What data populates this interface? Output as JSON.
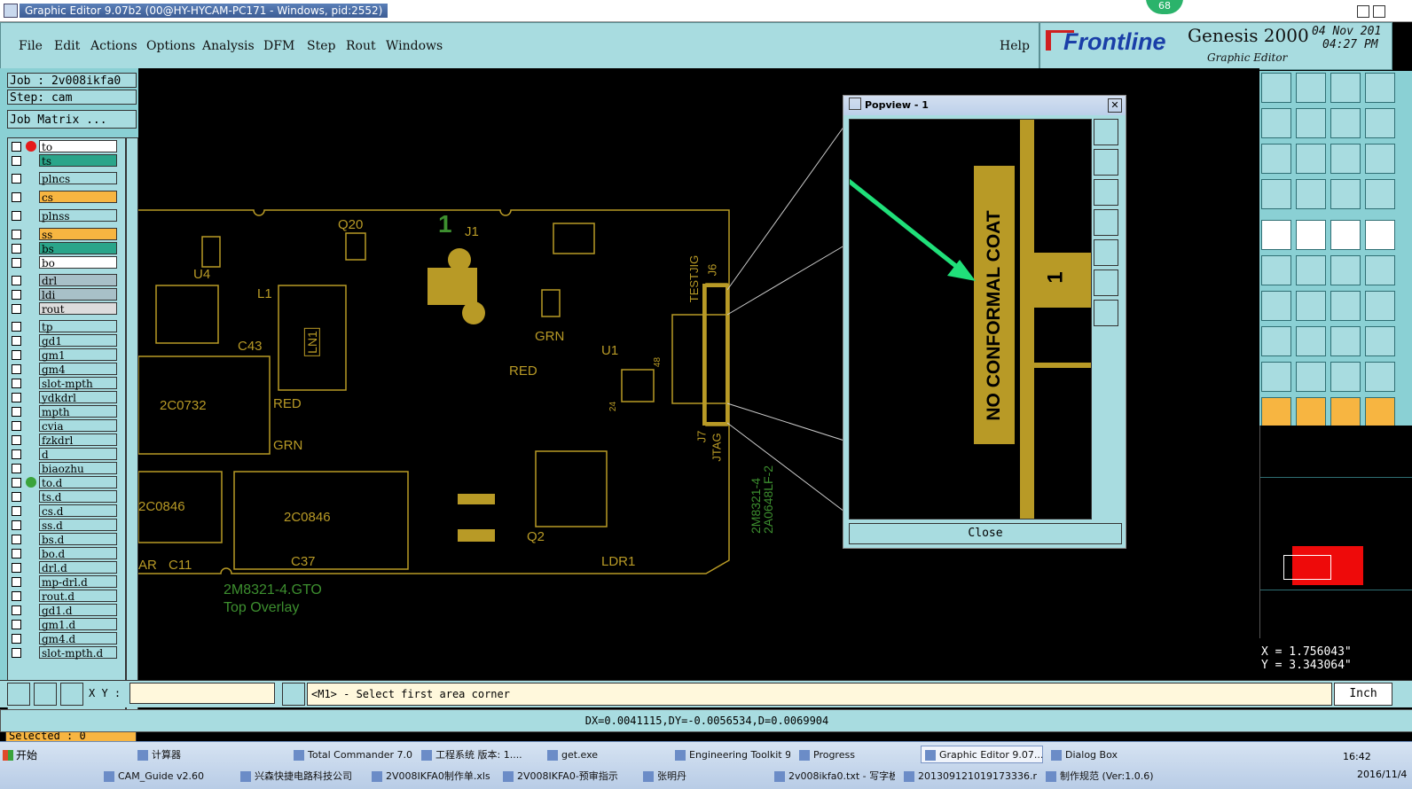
{
  "window": {
    "title": "Graphic Editor 9.07b2 (00@HY-HYCAM-PC171 - Windows, pid:2552)",
    "badge": "68"
  },
  "menu": [
    "File",
    "Edit",
    "Actions",
    "Options",
    "Analysis",
    "DFM",
    "Step",
    "Rout",
    "Windows"
  ],
  "help": "Help",
  "brand": {
    "logo": "Frontline",
    "product": "Genesis 2000",
    "subtitle": "Graphic Editor",
    "date": "04 Nov 201",
    "time": "04:27 PM"
  },
  "job": {
    "job_label": "Job : 2v008ikfa0",
    "step_label": "Step: cam",
    "matrix_button": "Job Matrix ..."
  },
  "layers": [
    {
      "name": "to",
      "color": "#ffffff",
      "marker": true
    },
    {
      "name": "ts",
      "color": "#2aa58a"
    },
    {
      "name": "plncs",
      "color": "#a8dce0"
    },
    {
      "name": "cs",
      "color": "#f7b541"
    },
    {
      "name": "plnss",
      "color": "#a8dce0"
    },
    {
      "name": "ss",
      "color": "#f7b541"
    },
    {
      "name": "bs",
      "color": "#2aa58a"
    },
    {
      "name": "bo",
      "color": "#ffffff"
    },
    {
      "name": "drl",
      "color": "#a8c0c8"
    },
    {
      "name": "ldi",
      "color": "#a8c0c8"
    },
    {
      "name": "rout",
      "color": "#dcdcdc"
    },
    {
      "name": "tp",
      "color": "#a8dce0"
    },
    {
      "name": "gd1",
      "color": "#a8dce0"
    },
    {
      "name": "gm1",
      "color": "#a8dce0"
    },
    {
      "name": "gm4",
      "color": "#a8dce0"
    },
    {
      "name": "slot-mpth",
      "color": "#a8dce0"
    },
    {
      "name": "ydkdrl",
      "color": "#a8dce0"
    },
    {
      "name": "mpth",
      "color": "#a8dce0"
    },
    {
      "name": "cvia",
      "color": "#a8dce0"
    },
    {
      "name": "fzkdrl",
      "color": "#a8dce0"
    },
    {
      "name": "d",
      "color": "#a8dce0"
    },
    {
      "name": "biaozhu",
      "color": "#a8dce0"
    },
    {
      "name": "to.d",
      "color": "#a8dce0",
      "marker": true
    },
    {
      "name": "ts.d",
      "color": "#a8dce0"
    },
    {
      "name": "cs.d",
      "color": "#a8dce0"
    },
    {
      "name": "ss.d",
      "color": "#a8dce0"
    },
    {
      "name": "bs.d",
      "color": "#a8dce0"
    },
    {
      "name": "bo.d",
      "color": "#a8dce0"
    },
    {
      "name": "drl.d",
      "color": "#a8dce0"
    },
    {
      "name": "mp-drl.d",
      "color": "#a8dce0"
    },
    {
      "name": "rout.d",
      "color": "#a8dce0"
    },
    {
      "name": "gd1.d",
      "color": "#a8dce0"
    },
    {
      "name": "gm1.d",
      "color": "#a8dce0"
    },
    {
      "name": "gm4.d",
      "color": "#a8dce0"
    },
    {
      "name": "slot-mpth.d",
      "color": "#a8dce0"
    }
  ],
  "selected": "Selected : 0",
  "popview": {
    "title": "Popview - 1",
    "text": "NO CONFORMAL COAT",
    "number": "1",
    "close_label": "Close"
  },
  "pcb": {
    "labels": [
      "Q20",
      "J1",
      "1",
      "U4",
      "L1",
      "C43",
      "LN1",
      "TESTJIG",
      "J6",
      "GRN",
      "RED",
      "U1",
      "48",
      "24",
      "2C0732",
      "RED",
      "GRN",
      "2C0846",
      "2C0846",
      "AR",
      "C11",
      "C37",
      "Q2",
      "LDR1",
      "J7",
      "JTAG"
    ],
    "rot_label_1": "2M8321-4",
    "rot_label_2": "2A0648LF-2",
    "caption_1": "2M8321-4.GTO",
    "caption_2": "Top Overlay"
  },
  "coords": {
    "x": "X = 1.756043\"",
    "y": "Y = 3.343064\""
  },
  "command": {
    "xy_label": "X Y :",
    "xy_value": "",
    "prompt": "<M1> - Select first area corner",
    "unit": "Inch"
  },
  "measure": "DX=0.0041115,DY=-0.0056534,D=0.0069904",
  "taskbar": {
    "start": "开始",
    "row1": [
      "计算器",
      "Total Commander 7.0...",
      "工程系统 版本: 1....",
      "get.exe",
      "Engineering Toolkit 9....",
      "Progress",
      "Graphic Editor 9.07...",
      "Dialog Box"
    ],
    "row2": [
      "CAM_Guide v2.60",
      "兴森快捷电路科技公司",
      "2V008IKFA0制作单.xls",
      "2V008IKFA0-预审指示",
      "张明丹",
      "2v008ikfa0.txt - 写字板",
      "201309121019173336.r",
      "制作规范 (Ver:1.0.6)"
    ],
    "clock": "16:42",
    "date": "2016/11/4"
  },
  "colors": {
    "accent": "#a8dce0",
    "pcb": "#b89a26",
    "silk": "#3d8f2f",
    "highlight": "#f7b541"
  }
}
